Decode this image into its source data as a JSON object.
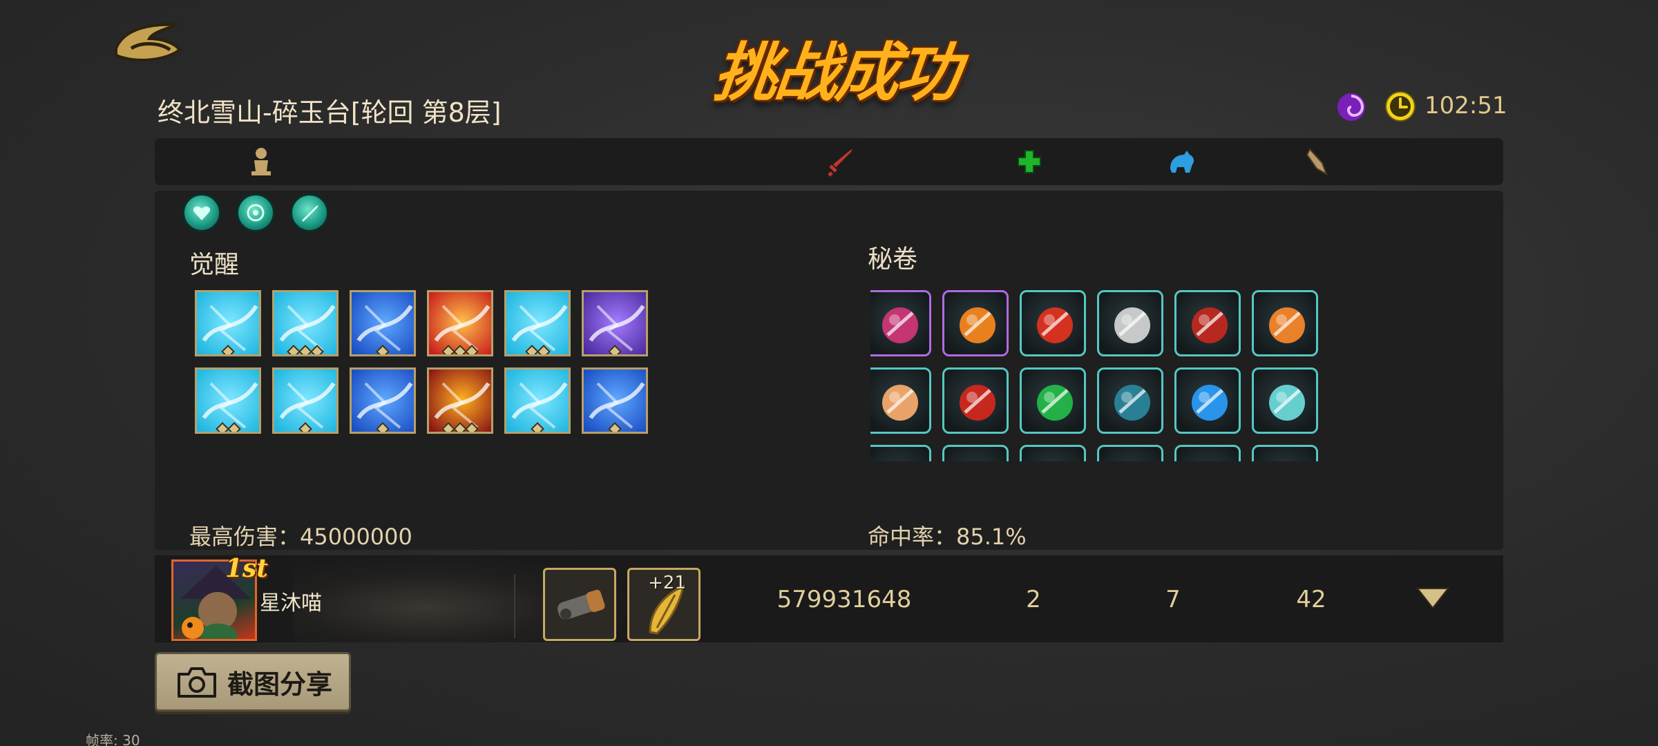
{
  "header": {
    "title": "挑战成功",
    "stage": "终北雪山-碎玉台[轮回 第8层]",
    "timer": "102:51"
  },
  "tabs": [
    {
      "icon": "character-icon",
      "color": "#c6a56a"
    },
    {
      "icon": "sword-icon",
      "color": "#c2362a"
    },
    {
      "icon": "health-cross-icon",
      "color": "#1fb52a"
    },
    {
      "icon": "pet-icon",
      "color": "#2d9ee0"
    },
    {
      "icon": "scroll-icon",
      "color": "#b59a6a"
    }
  ],
  "awakening": {
    "title": "觉醒",
    "pip_counts": [
      1,
      3,
      1,
      3,
      2,
      1,
      2,
      1,
      1,
      3,
      1,
      1
    ]
  },
  "scrolls": {
    "title": "秘卷"
  },
  "stats": {
    "max_damage": "最高伤害：45000000",
    "hit_rate": "命中率：85.1%"
  },
  "player": {
    "rank": "1st",
    "name": "星沐喵",
    "equip_plus": "+21",
    "score": "579931648",
    "col2": "2",
    "col3": "7",
    "col4": "42"
  },
  "share": {
    "label": "截图分享"
  },
  "fps": "帧率: 30"
}
